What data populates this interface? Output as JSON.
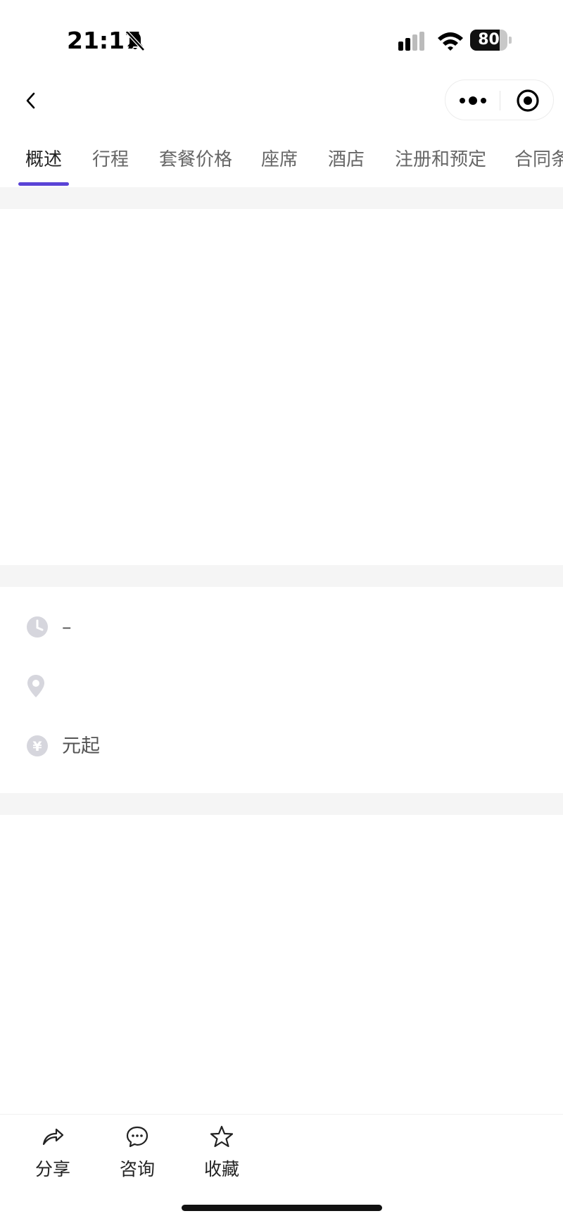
{
  "status_bar": {
    "time": "21:17",
    "battery": "80",
    "battery_fraction": 0.8,
    "icons": [
      "bell-off-icon",
      "signal-icon",
      "wifi-icon",
      "battery-icon"
    ]
  },
  "nav": {
    "back_icon": "chevron-left-icon",
    "more_icon": "more-dots-icon",
    "close_icon": "target-close-icon"
  },
  "tabs": {
    "active_index": 0,
    "items": [
      {
        "label": "概述"
      },
      {
        "label": "行程"
      },
      {
        "label": "套餐价格"
      },
      {
        "label": "座席"
      },
      {
        "label": "酒店"
      },
      {
        "label": "注册和预定"
      },
      {
        "label": "合同条款"
      }
    ],
    "accent_color": "#5a43d6"
  },
  "info": {
    "time_value": "–",
    "location_value": "",
    "price_value": "元起",
    "icons": [
      "clock-icon",
      "location-pin-icon",
      "yen-icon"
    ]
  },
  "bottom_bar": {
    "share_label": "分享",
    "consult_label": "咨询",
    "favorite_label": "收藏",
    "icons": [
      "share-icon",
      "chat-icon",
      "star-icon"
    ]
  }
}
